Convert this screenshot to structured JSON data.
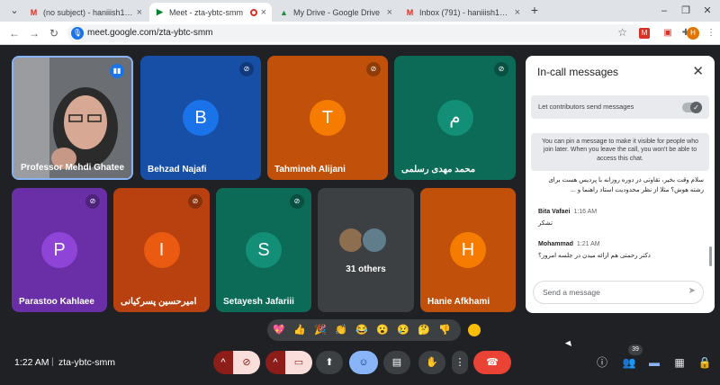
{
  "browser": {
    "tabs": [
      {
        "title": "(no subject) - haniiish1400@gm",
        "icon": "gmail-icon",
        "active": false
      },
      {
        "title": "Meet - zta-ybtc-smm",
        "icon": "meet-icon",
        "active": true
      },
      {
        "title": "My Drive - Google Drive",
        "icon": "drive-icon",
        "active": false
      },
      {
        "title": "Inbox (791) - haniiish1400@gm",
        "icon": "gmail-icon",
        "active": false
      }
    ],
    "new_tab_glyph": "+",
    "close_glyph": "×",
    "url": "meet.google.com/zta-ybtc-smm",
    "profile_initial": "H"
  },
  "participants": [
    {
      "name": "Professor Mehdi Ghatee",
      "initial": "",
      "color": "#4a4f55",
      "speaking": true,
      "muted": false
    },
    {
      "name": "Behzad Najafi",
      "initial": "B",
      "color": "#1a73e8",
      "muted": true
    },
    {
      "name": "Tahmineh Alijani",
      "initial": "T",
      "color": "#e8710a",
      "muted": true
    },
    {
      "name": "محمد مهدی رسلمی",
      "initial": "م",
      "color": "#128f76",
      "muted": true
    },
    {
      "name": "Parastoo Kahlaee",
      "initial": "P",
      "color": "#8430ce",
      "muted": true
    },
    {
      "name": "امیرحسین پسرکیانی",
      "initial": "I",
      "color": "#e8410a",
      "muted": true
    },
    {
      "name": "Setayesh Jafariii",
      "initial": "S",
      "color": "#128f76",
      "muted": true
    },
    {
      "name": "Hanie Afkhami",
      "initial": "H",
      "color": "#e8710a",
      "muted": false
    }
  ],
  "others_label": "31 others",
  "chat": {
    "title": "In-call messages",
    "toggle_label": "Let contributors send messages",
    "info": "You can pin a message to make it visible for people who join later. When you leave the call, you won't be able to access this chat.",
    "messages": [
      {
        "sender": "",
        "time": "",
        "text": "سلام وقت بخیر، تقاوتی در دوره روزانه با پردیس هست برای رشته هوش؟ مثلا از نظر محدودیت استاد راهنما و ..."
      },
      {
        "sender": "Bita Vafaei",
        "time": "1:16 AM",
        "text": "تشکر"
      },
      {
        "sender": "Mohammad",
        "time": "1:21 AM",
        "text": "دکتر رحمتی هم ارائه میدن در جلسه امروز؟"
      }
    ],
    "send_placeholder": "Send a message"
  },
  "reactions": [
    "💖",
    "👍",
    "🎉",
    "👏",
    "😂",
    "😮",
    "😢",
    "🤔",
    "👎"
  ],
  "bottom": {
    "time": "1:22 AM",
    "separator": "|",
    "meeting_code": "zta-ybtc-smm",
    "people_count": "39"
  },
  "colors": {
    "meet_bg": "#202124",
    "end_call": "#ea4335",
    "muted_control": "#8c1d18",
    "active_control": "#8ab4f8"
  }
}
